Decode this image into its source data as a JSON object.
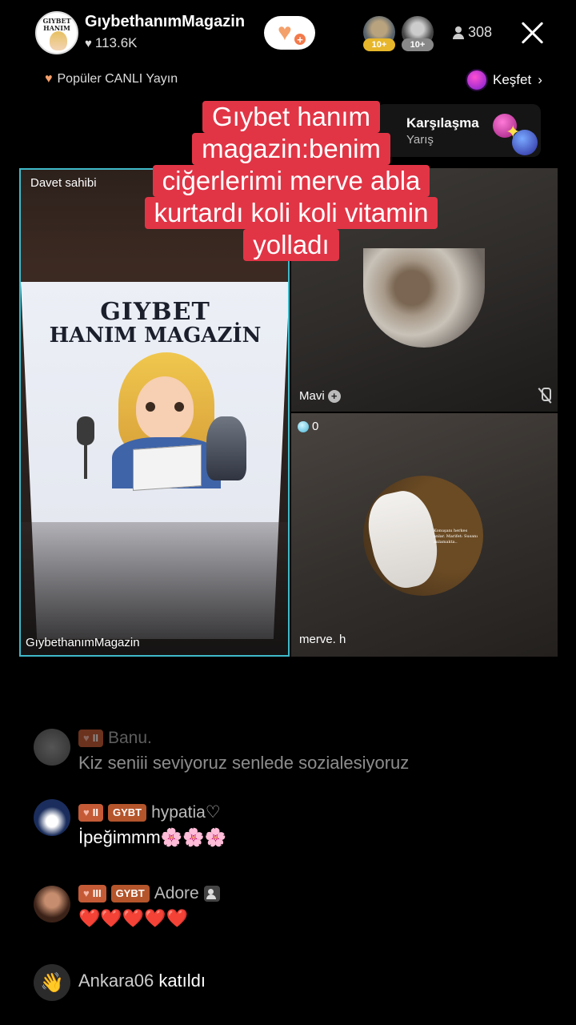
{
  "host": {
    "name": "GıybethanımMagazin",
    "likes": "113.6K",
    "avatar_text": "GIYBET HANIM"
  },
  "viewers": {
    "badge1": "10+",
    "badge2": "10+",
    "count": "308"
  },
  "nav": {
    "popular_label": "Popüler CANLI Yayın",
    "explore_label": "Keşfet"
  },
  "match": {
    "title": "Karşılaşma",
    "subtitle": "Yarış"
  },
  "caption_lines": [
    "Gıybet hanım",
    "magazin:benim",
    "ciğerlerimi merve abla",
    "kurtardı koli koli vitamin",
    "yolladı"
  ],
  "panels": {
    "host_label_top": "Davet sahibi",
    "host_label_bottom": "GıybethanımMagazin",
    "lamp_line1": "GIYBET",
    "lamp_line2": "HANIM MAGAZİN",
    "guest1_name": "Mavi",
    "guest2_gems": "0",
    "guest2_name": "merve. h",
    "guest2_avatar_text": "Konuşanı herkes anlar. Marifet: Susanı anlamakta.."
  },
  "chat": [
    {
      "level": "II",
      "badge": "",
      "user": "Banu.",
      "text": "Kiz seniii seviyoruz senlede sozialesiyoruz",
      "faded": true
    },
    {
      "level": "II",
      "badge": "GYBT",
      "user": "hypatia♡",
      "text": "İpeğimmm🌸🌸🌸",
      "faded": false
    },
    {
      "level": "III",
      "badge": "GYBT",
      "user": "Adore",
      "text": "❤️❤️❤️❤️❤️",
      "faded": false
    }
  ],
  "joined": {
    "user": "Ankara06",
    "action": "katıldı"
  },
  "colors": {
    "caption_bg": "#e13546",
    "host_border": "#3fb9c9",
    "level_badge": "#c45b36"
  }
}
